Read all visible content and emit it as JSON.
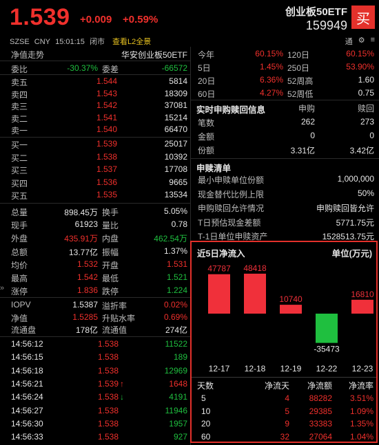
{
  "header": {
    "price": "1.539",
    "change": "+0.009",
    "change_pct": "+0.59%",
    "exchange": "SZSE",
    "currency": "CNY",
    "time": "15:01:15",
    "status": "闭市",
    "l2_link": "查看L2全景",
    "name": "创业板50ETF",
    "code": "159949",
    "buy_label": "买",
    "tools": [
      "通",
      "⚙",
      "≡"
    ]
  },
  "depth": {
    "title": "净值走势",
    "fund_name": "华安创业板50ETF",
    "weibi_label": "委比",
    "weibi": "-30.37%",
    "weicha_label": "委差",
    "weicha": "-66572",
    "asks": [
      {
        "label": "卖五",
        "price": "1.544",
        "vol": "5814"
      },
      {
        "label": "卖四",
        "price": "1.543",
        "vol": "18309"
      },
      {
        "label": "卖三",
        "price": "1.542",
        "vol": "37081"
      },
      {
        "label": "卖二",
        "price": "1.541",
        "vol": "15214"
      },
      {
        "label": "卖一",
        "price": "1.540",
        "vol": "66470"
      }
    ],
    "bids": [
      {
        "label": "买一",
        "price": "1.539",
        "vol": "25017"
      },
      {
        "label": "买二",
        "price": "1.538",
        "vol": "10392"
      },
      {
        "label": "买三",
        "price": "1.537",
        "vol": "17708"
      },
      {
        "label": "买四",
        "price": "1.536",
        "vol": "9665"
      },
      {
        "label": "买五",
        "price": "1.535",
        "vol": "13534"
      }
    ]
  },
  "stats": [
    {
      "l1": "总量",
      "v1": "898.45万",
      "c1": "white",
      "l2": "换手",
      "v2": "5.05%",
      "c2": "white"
    },
    {
      "l1": "现手",
      "v1": "61923",
      "c1": "white",
      "l2": "量比",
      "v2": "0.78",
      "c2": "white"
    },
    {
      "l1": "外盘",
      "v1": "435.91万",
      "c1": "red",
      "l2": "内盘",
      "v2": "462.54万",
      "c2": "green"
    },
    {
      "l1": "总额",
      "v1": "13.77亿",
      "c1": "white",
      "l2": "振幅",
      "v2": "1.37%",
      "c2": "white"
    },
    {
      "l1": "均价",
      "v1": "1.532",
      "c1": "red",
      "l2": "开盘",
      "v2": "1.531",
      "c2": "red"
    },
    {
      "l1": "最高",
      "v1": "1.542",
      "c1": "red",
      "l2": "最低",
      "v2": "1.521",
      "c2": "green"
    },
    {
      "l1": "涨停",
      "v1": "1.836",
      "c1": "red",
      "l2": "跌停",
      "v2": "1.224",
      "c2": "green"
    }
  ],
  "iopv": [
    {
      "l1": "IOPV",
      "v1": "1.5387",
      "c1": "white",
      "l2": "溢折率",
      "v2": "0.02%",
      "c2": "red"
    },
    {
      "l1": "净值",
      "v1": "1.5285",
      "c1": "red",
      "l2": "升贴水率",
      "v2": "0.69%",
      "c2": "red"
    },
    {
      "l1": "流通盘",
      "v1": "178亿",
      "c1": "white",
      "l2": "流通值",
      "v2": "274亿",
      "c2": "white"
    }
  ],
  "ticks": [
    {
      "t": "14:56:12",
      "p": "1.538",
      "a": "",
      "v": "11522",
      "c": "green"
    },
    {
      "t": "14:56:15",
      "p": "1.538",
      "a": "",
      "v": "189",
      "c": "green"
    },
    {
      "t": "14:56:18",
      "p": "1.538",
      "a": "",
      "v": "12969",
      "c": "green"
    },
    {
      "t": "14:56:21",
      "p": "1.539",
      "a": "↑",
      "v": "1648",
      "c": "red"
    },
    {
      "t": "14:56:24",
      "p": "1.538",
      "a": "↓",
      "v": "4191",
      "c": "green"
    },
    {
      "t": "14:56:27",
      "p": "1.538",
      "a": "",
      "v": "11946",
      "c": "green"
    },
    {
      "t": "14:56:30",
      "p": "1.538",
      "a": "",
      "v": "1957",
      "c": "green"
    },
    {
      "t": "14:56:33",
      "p": "1.538",
      "a": "",
      "v": "927",
      "c": "green"
    }
  ],
  "perf": [
    {
      "l1": "今年",
      "v1": "60.15%",
      "l2": "120日",
      "v2": "60.15%",
      "c2": "red"
    },
    {
      "l1": "5日",
      "v1": "1.45%",
      "l2": "250日",
      "v2": "53.90%",
      "c2": "red"
    },
    {
      "l1": "20日",
      "v1": "6.36%",
      "l2": "52周高",
      "v2": "1.60",
      "c2": "white"
    },
    {
      "l1": "60日",
      "v1": "4.27%",
      "l2": "52周低",
      "v2": "0.75",
      "c2": "white"
    }
  ],
  "realtime": {
    "title": "实时申购赎回信息",
    "col1": "申购",
    "col2": "赎回",
    "rows": [
      {
        "label": "笔数",
        "a": "262",
        "b": "273"
      },
      {
        "label": "金额",
        "a": "0",
        "b": "0"
      },
      {
        "label": "份额",
        "a": "3.31亿",
        "b": "3.42亿"
      }
    ]
  },
  "list": {
    "title": "申赎清单",
    "rows": [
      {
        "label": "最小申赎单位份额",
        "value": "1,000,000"
      },
      {
        "label": "现金替代比例上限",
        "value": "50%"
      },
      {
        "label": "申购赎回允许情况",
        "value": "申购赎回皆允许"
      },
      {
        "label": "T日预估现金差额",
        "value": "5771.75元"
      },
      {
        "label": "T-1日单位申赎资产",
        "value": "1528513.75元"
      }
    ]
  },
  "flow": {
    "title": "近5日净流入",
    "unit": "单位(万元)",
    "table_headers": [
      "天数",
      "净流天",
      "净流额",
      "净流率"
    ],
    "table": [
      {
        "d": "5",
        "n": "4",
        "a": "88282",
        "r": "3.51%"
      },
      {
        "d": "10",
        "n": "5",
        "a": "29385",
        "r": "1.09%"
      },
      {
        "d": "20",
        "n": "9",
        "a": "33383",
        "r": "1.35%"
      },
      {
        "d": "60",
        "n": "32",
        "a": "27064",
        "r": "1.04%"
      }
    ]
  },
  "chart_data": {
    "type": "bar",
    "title": "近5日净流入",
    "ylabel": "单位(万元)",
    "categories": [
      "12-17",
      "12-18",
      "12-19",
      "12-22",
      "12-23"
    ],
    "values": [
      47787,
      48418,
      10740,
      -35473,
      16810
    ],
    "colors": {
      "positive": "#f0303a",
      "negative": "#1fbf3f"
    }
  },
  "side_arrow": "»"
}
